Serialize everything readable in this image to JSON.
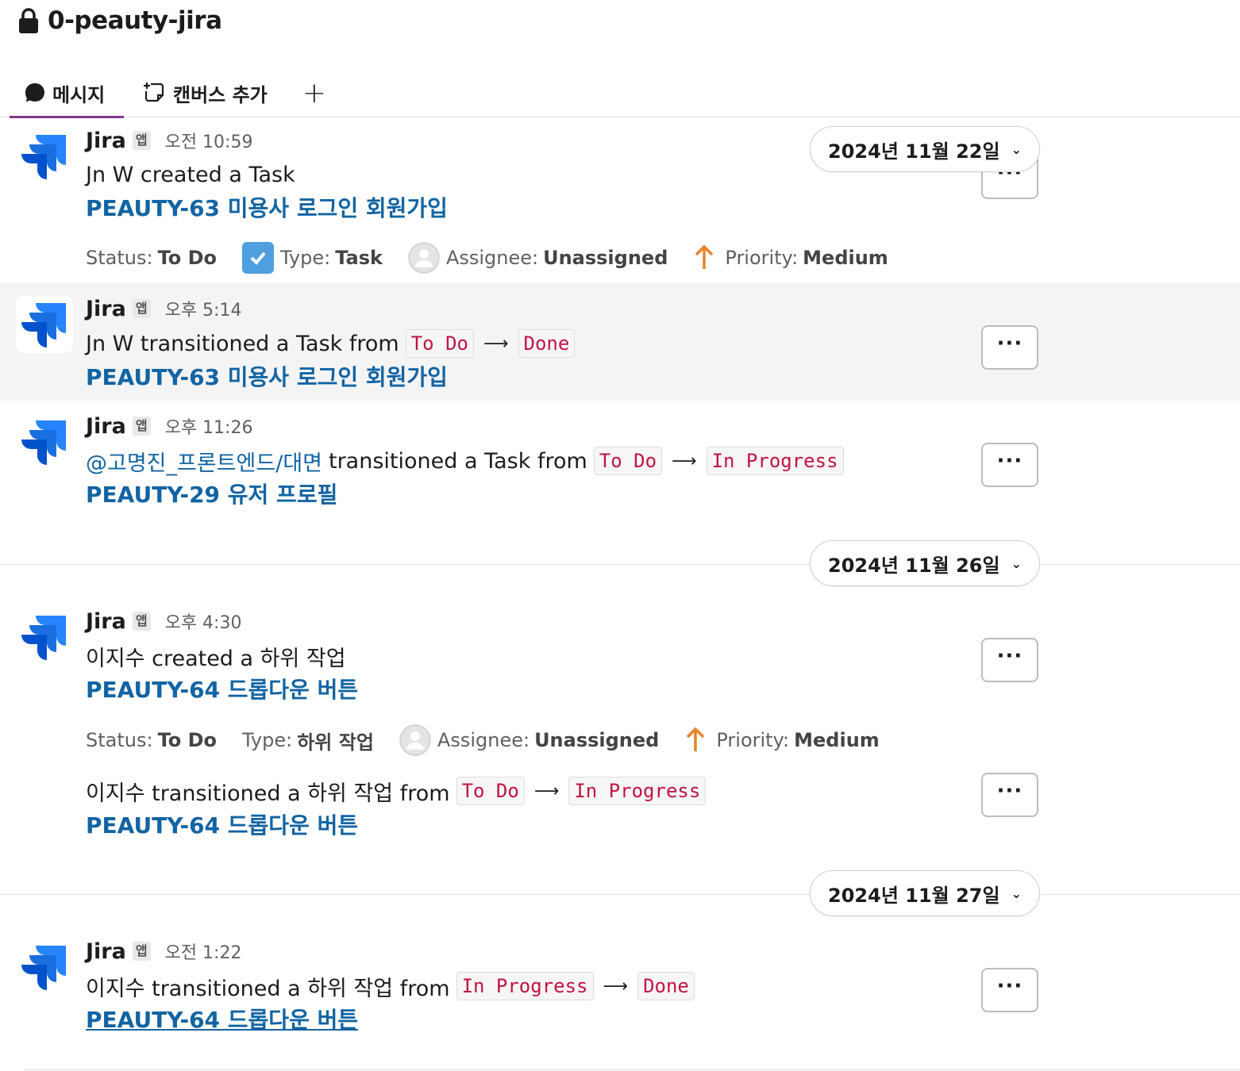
{
  "channel": {
    "name": "0-peauty-jira"
  },
  "tabs": [
    {
      "label": "메시지",
      "icon": "message-bubble-icon"
    },
    {
      "label": "캔버스 추가",
      "icon": "canvas-add-icon"
    },
    {
      "label": "+",
      "icon": "plus-icon"
    }
  ],
  "dates": [
    "2024년 11월 22일",
    "2024년 11월 26일",
    "2024년 11월 27일"
  ],
  "messages": [
    {
      "sender": "Jira",
      "badge": "앱",
      "time": "오전 10:59",
      "text": "Jn W created a Task",
      "link": "PEAUTY-63 미용사 로그인 회원가입",
      "fields": {
        "status_label": "Status:",
        "status": "To Do",
        "type_label": "Type:",
        "type": "Task",
        "assignee_label": "Assignee:",
        "assignee": "Unassigned",
        "priority_label": "Priority:",
        "priority": "Medium"
      }
    },
    {
      "sender": "Jira",
      "badge": "앱",
      "time": "오후 5:14",
      "prefix": "Jn W transitioned a Task from",
      "from": "To Do",
      "to": "Done",
      "link": "PEAUTY-63 미용사 로그인 회원가입"
    },
    {
      "sender": "Jira",
      "badge": "앱",
      "time": "오후 11:26",
      "mention": "@고명진_프론트엔드/대면",
      "prefix": "transitioned a Task from",
      "from": "To Do",
      "to": "In Progress",
      "link": "PEAUTY-29 유저 프로필"
    },
    {
      "sender": "Jira",
      "badge": "앱",
      "time": "오후 4:30",
      "text": "이지수 created a 하위 작업",
      "link": "PEAUTY-64 드롭다운 버튼",
      "fields": {
        "status_label": "Status:",
        "status": "To Do",
        "type_label": "Type:",
        "type": "하위 작업",
        "assignee_label": "Assignee:",
        "assignee": "Unassigned",
        "priority_label": "Priority:",
        "priority": "Medium"
      }
    },
    {
      "prefix": "이지수 transitioned a 하위 작업 from",
      "from": "To Do",
      "to": "In Progress",
      "link": "PEAUTY-64 드롭다운 버튼"
    },
    {
      "sender": "Jira",
      "badge": "앱",
      "time": "오전 1:22",
      "prefix": "이지수 transitioned a 하위 작업 from",
      "from": "In Progress",
      "to": "Done",
      "link": "PEAUTY-64 드롭다운 버튼"
    }
  ],
  "arrow": "⟶",
  "more_label": "···",
  "colors": {
    "link": "#1264a3",
    "code_text": "#c01343",
    "tab_underline": "#7e3a8d",
    "priority_arrow": "#e8832a",
    "checkbox": "#4e9fe0"
  }
}
